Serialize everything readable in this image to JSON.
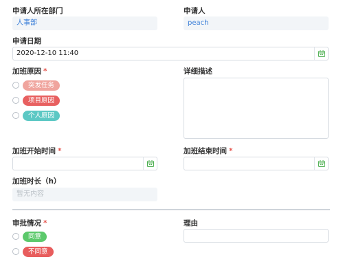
{
  "fields": {
    "department": {
      "label": "申请人所在部门",
      "value": "人事部"
    },
    "applicant": {
      "label": "申请人",
      "value": "peach"
    },
    "apply_date": {
      "label": "申请日期",
      "value": "2020-12-10 11:40",
      "icon": "calendar-icon"
    },
    "overtime_reason": {
      "label": "加班原因",
      "required_mark": "*",
      "options": [
        {
          "label": "突发任务",
          "color": "#f0a59e"
        },
        {
          "label": "项目原因",
          "color": "#e86060"
        },
        {
          "label": "个人原因",
          "color": "#5cc8c4"
        }
      ]
    },
    "detail": {
      "label": "详细描述",
      "value": ""
    },
    "start_time": {
      "label": "加班开始时间",
      "required_mark": "*",
      "value": "",
      "icon": "calendar-icon"
    },
    "end_time": {
      "label": "加班结束时间",
      "required_mark": "*",
      "value": "",
      "icon": "calendar-icon"
    },
    "duration": {
      "label": "加班时长（h）",
      "value": "暂无内容"
    },
    "approval": {
      "label": "审批情况",
      "required_mark": "*",
      "options": [
        {
          "label": "同意",
          "color": "#5cc96b"
        },
        {
          "label": "不同意",
          "color": "#e85d5d"
        }
      ]
    },
    "reason": {
      "label": "理由",
      "value": ""
    }
  },
  "colors": {
    "accent_blue": "#3a7ed8",
    "required_red": "#e5534b",
    "calendar_green": "#4caf50"
  }
}
